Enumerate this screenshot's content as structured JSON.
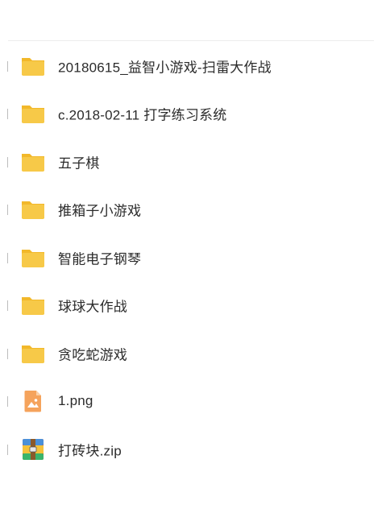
{
  "files": [
    {
      "name": "20180615_益智小游戏-扫雷大作战",
      "icon": "folder-icon"
    },
    {
      "name": "c.2018-02-11 打字练习系统",
      "icon": "folder-icon"
    },
    {
      "name": "五子棋",
      "icon": "folder-icon"
    },
    {
      "name": "推箱子小游戏",
      "icon": "folder-icon"
    },
    {
      "name": "智能电子钢琴",
      "icon": "folder-icon"
    },
    {
      "name": "球球大作战",
      "icon": "folder-icon"
    },
    {
      "name": "贪吃蛇游戏",
      "icon": "folder-icon"
    },
    {
      "name": "1.png",
      "icon": "image-file-icon"
    },
    {
      "name": "打砖块.zip",
      "icon": "zip-archive-icon"
    }
  ],
  "colors": {
    "folder": "#f7c948",
    "folder_back": "#f2b82a",
    "image_file": "#f5a35c",
    "archive": "#e8453c"
  }
}
